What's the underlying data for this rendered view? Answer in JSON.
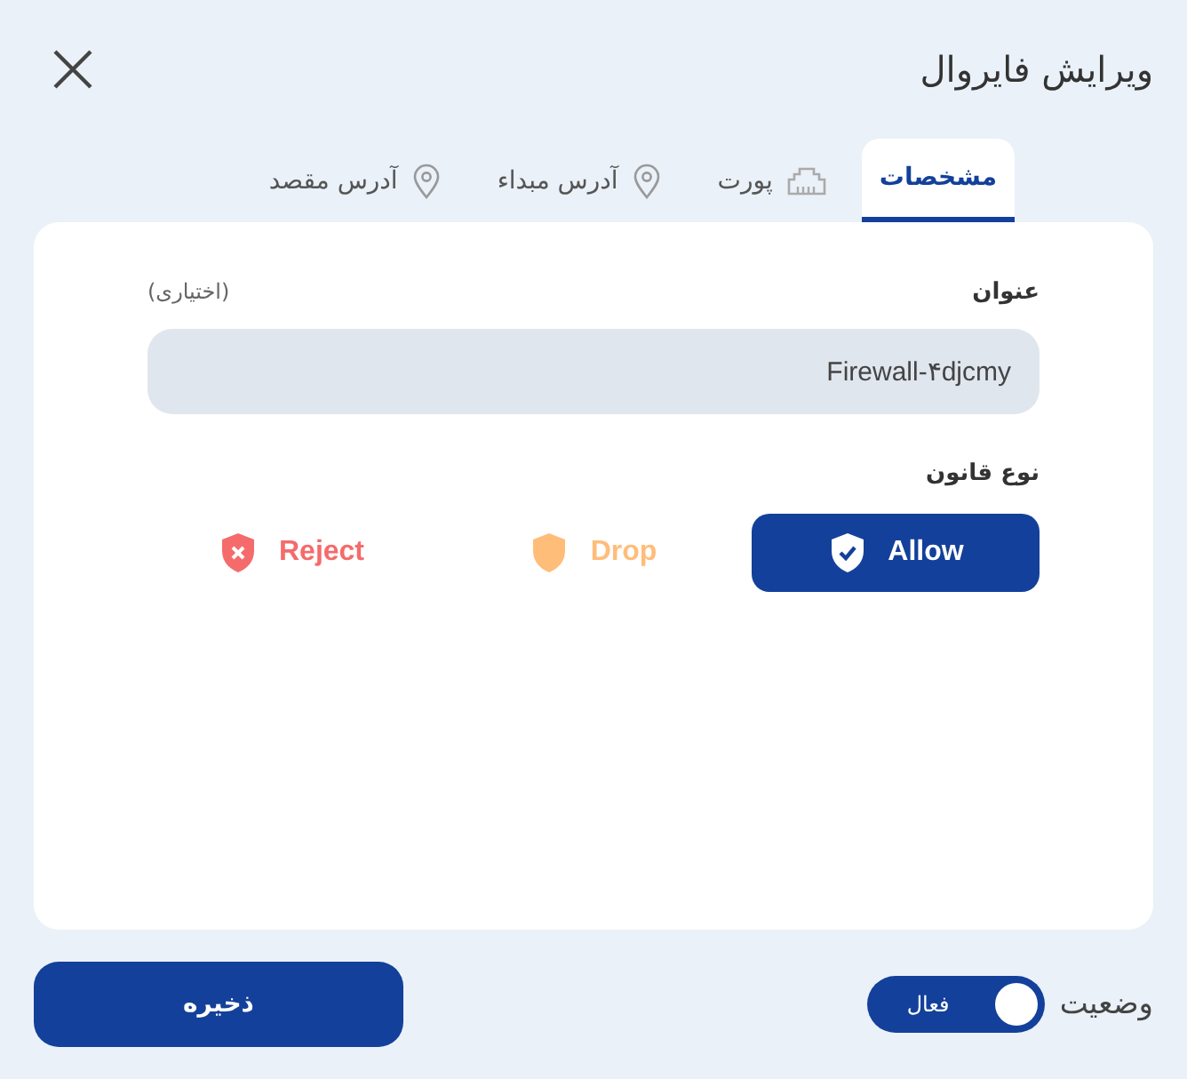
{
  "window": {
    "title": "ویرایش فایروال"
  },
  "tabs": [
    {
      "label": "مشخصات",
      "kind": "none",
      "selected": true
    },
    {
      "label": "پورت",
      "kind": "port",
      "selected": false
    },
    {
      "label": "آدرس مبداء",
      "kind": "pin",
      "selected": false
    },
    {
      "label": "آدرس مقصد",
      "kind": "pin",
      "selected": false
    }
  ],
  "title_field": {
    "label": "عنوان",
    "hint": "(اختیاری)",
    "value": "Firewall-۴djcmy"
  },
  "rule_type": {
    "label": "نوع قانون",
    "options": [
      {
        "label": "Allow",
        "kind": "allow",
        "selected": true
      },
      {
        "label": "Drop",
        "kind": "drop",
        "selected": false
      },
      {
        "label": "Reject",
        "kind": "reject",
        "selected": false
      }
    ]
  },
  "status": {
    "label": "وضعیت",
    "toggle_label": "فعال",
    "on": true
  },
  "save_button": "ذخیره"
}
